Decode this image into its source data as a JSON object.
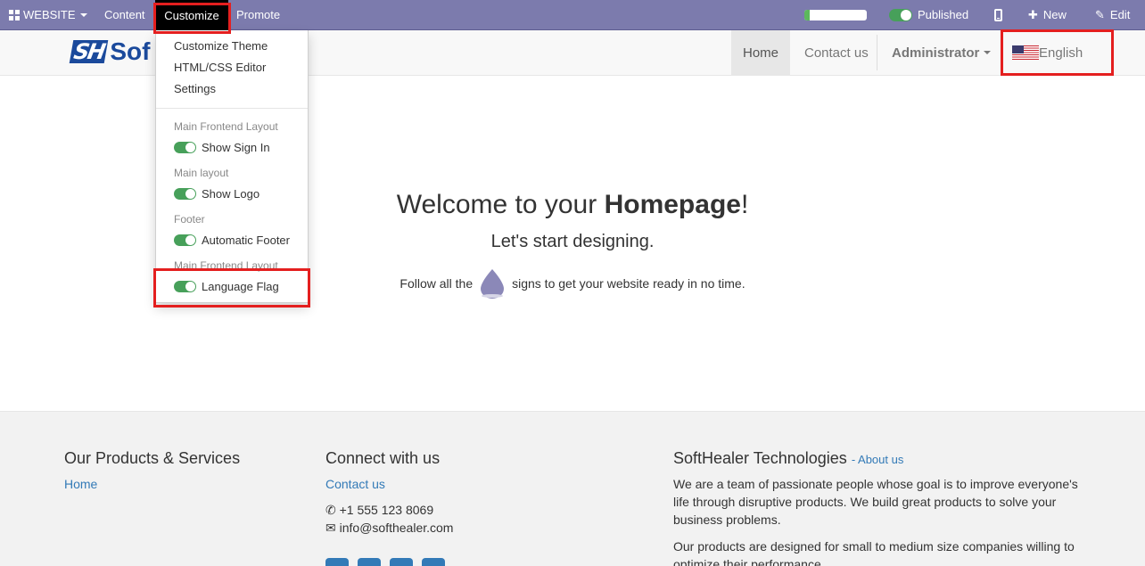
{
  "topbar": {
    "website_label": "WEBSITE",
    "content_label": "Content",
    "customize_label": "Customize",
    "promote_label": "Promote",
    "seo_progress": 0.08,
    "published_label": "Published",
    "new_label": "New",
    "edit_label": "Edit",
    "bg_color": "#7c7bad"
  },
  "header": {
    "logo_text": "Sof",
    "logo_mark": "SH",
    "nav": {
      "home": "Home",
      "contact": "Contact us",
      "admin": "Administrator",
      "language": "English"
    }
  },
  "customize_menu": {
    "items": [
      "Customize Theme",
      "HTML/CSS Editor",
      "Settings"
    ],
    "groups": [
      {
        "header": "Main Frontend Layout",
        "option": "Show Sign In",
        "enabled": true
      },
      {
        "header": "Main layout",
        "option": "Show Logo",
        "enabled": true
      },
      {
        "header": "Footer",
        "option": "Automatic Footer",
        "enabled": true
      },
      {
        "header": "Main Frontend Layout",
        "option": "Language Flag",
        "enabled": true
      }
    ]
  },
  "main": {
    "welcome_prefix": "Welcome to your ",
    "welcome_bold": "Homepage",
    "welcome_suffix": "!",
    "subtitle": "Let's start designing.",
    "follow_prefix": "Follow all the",
    "follow_suffix": "signs to get your website ready in no time."
  },
  "footer": {
    "col1": {
      "title": "Our Products & Services",
      "link": "Home"
    },
    "col2": {
      "title": "Connect with us",
      "link": "Contact us",
      "phone": "+1 555 123 8069",
      "email": "info@softhealer.com"
    },
    "col3": {
      "title": "SoftHealer Technologies",
      "title_link": "- About us",
      "para1": "We are a team of passionate people whose goal is to improve everyone's life through disruptive products. We build great products to solve your business problems.",
      "para2": "Our products are designed for small to medium size companies willing to optimize their performance."
    }
  },
  "colors": {
    "highlight": "#e41f1f",
    "toggle_on": "#47a05a",
    "link": "#337ab7"
  }
}
